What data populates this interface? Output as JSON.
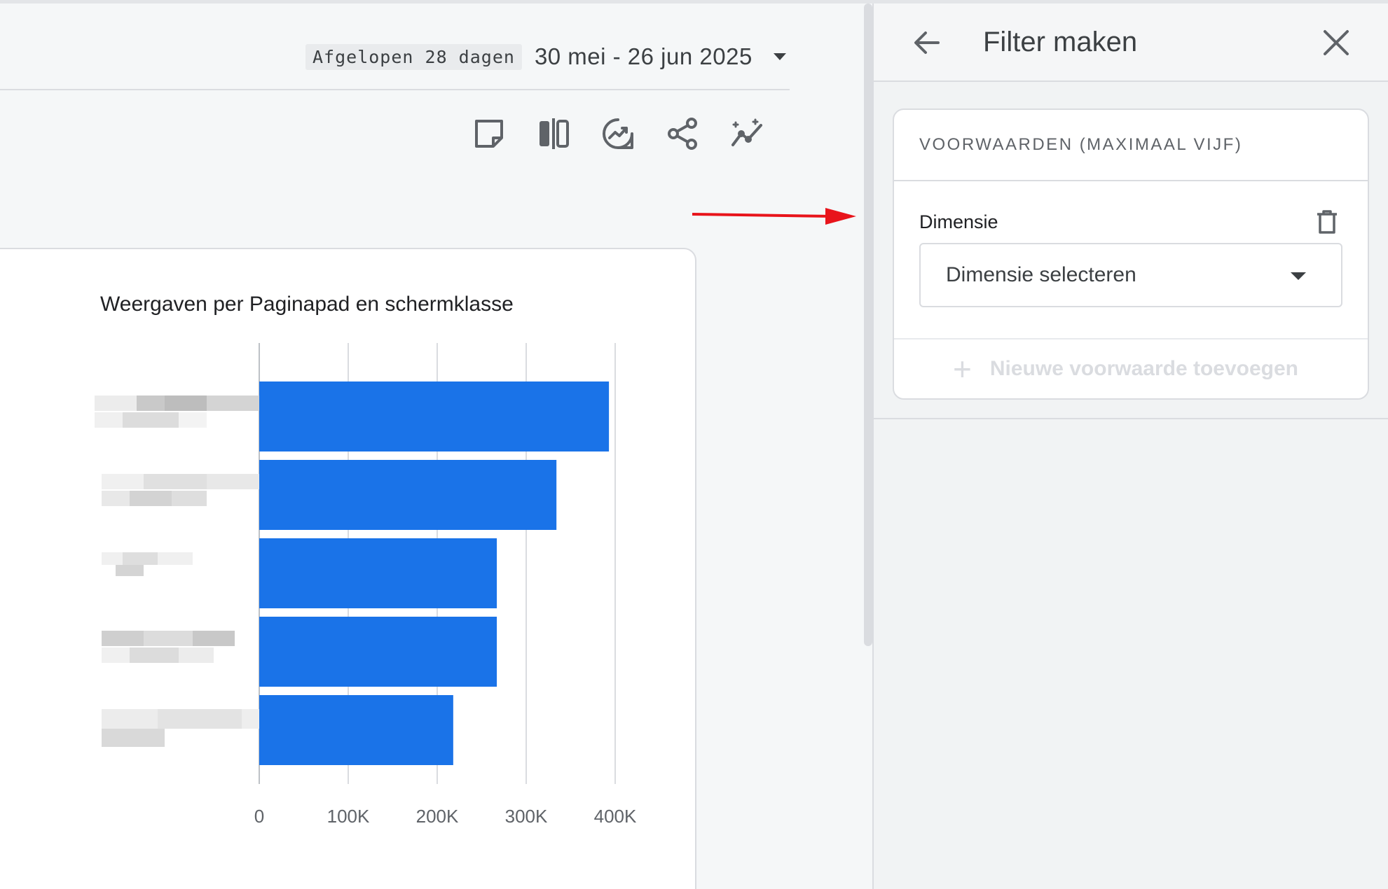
{
  "date_range": {
    "preset": "Afgelopen 28 dagen",
    "value": "30 mei - 26 jun 2025"
  },
  "toolbar": {
    "icons": [
      "note-icon",
      "compare-icon",
      "insights-icon",
      "share-icon",
      "anomaly-icon"
    ]
  },
  "chart": {
    "title": "Weergaven per Paginapad en schermklasse"
  },
  "chart_data": {
    "type": "bar",
    "orientation": "horizontal",
    "title": "Weergaven per Paginapad en schermklasse",
    "categories": [
      "",
      "",
      "",
      "",
      ""
    ],
    "values": [
      393000,
      334000,
      267000,
      267000,
      218000
    ],
    "xlim": [
      0,
      400000
    ],
    "xticks": [
      "0",
      "100K",
      "200K",
      "300K",
      "400K"
    ],
    "grid": true,
    "bar_color": "#1a73e8"
  },
  "panel": {
    "title": "Filter maken",
    "conditions_header": "VOORWAARDEN (MAXIMAAL VIJF)",
    "dimension_label": "Dimensie",
    "dimension_placeholder": "Dimensie selecteren",
    "add_condition": "Nieuwe voorwaarde toevoegen"
  },
  "colors": {
    "accent": "#1a73e8",
    "arrow": "#e8141b"
  }
}
